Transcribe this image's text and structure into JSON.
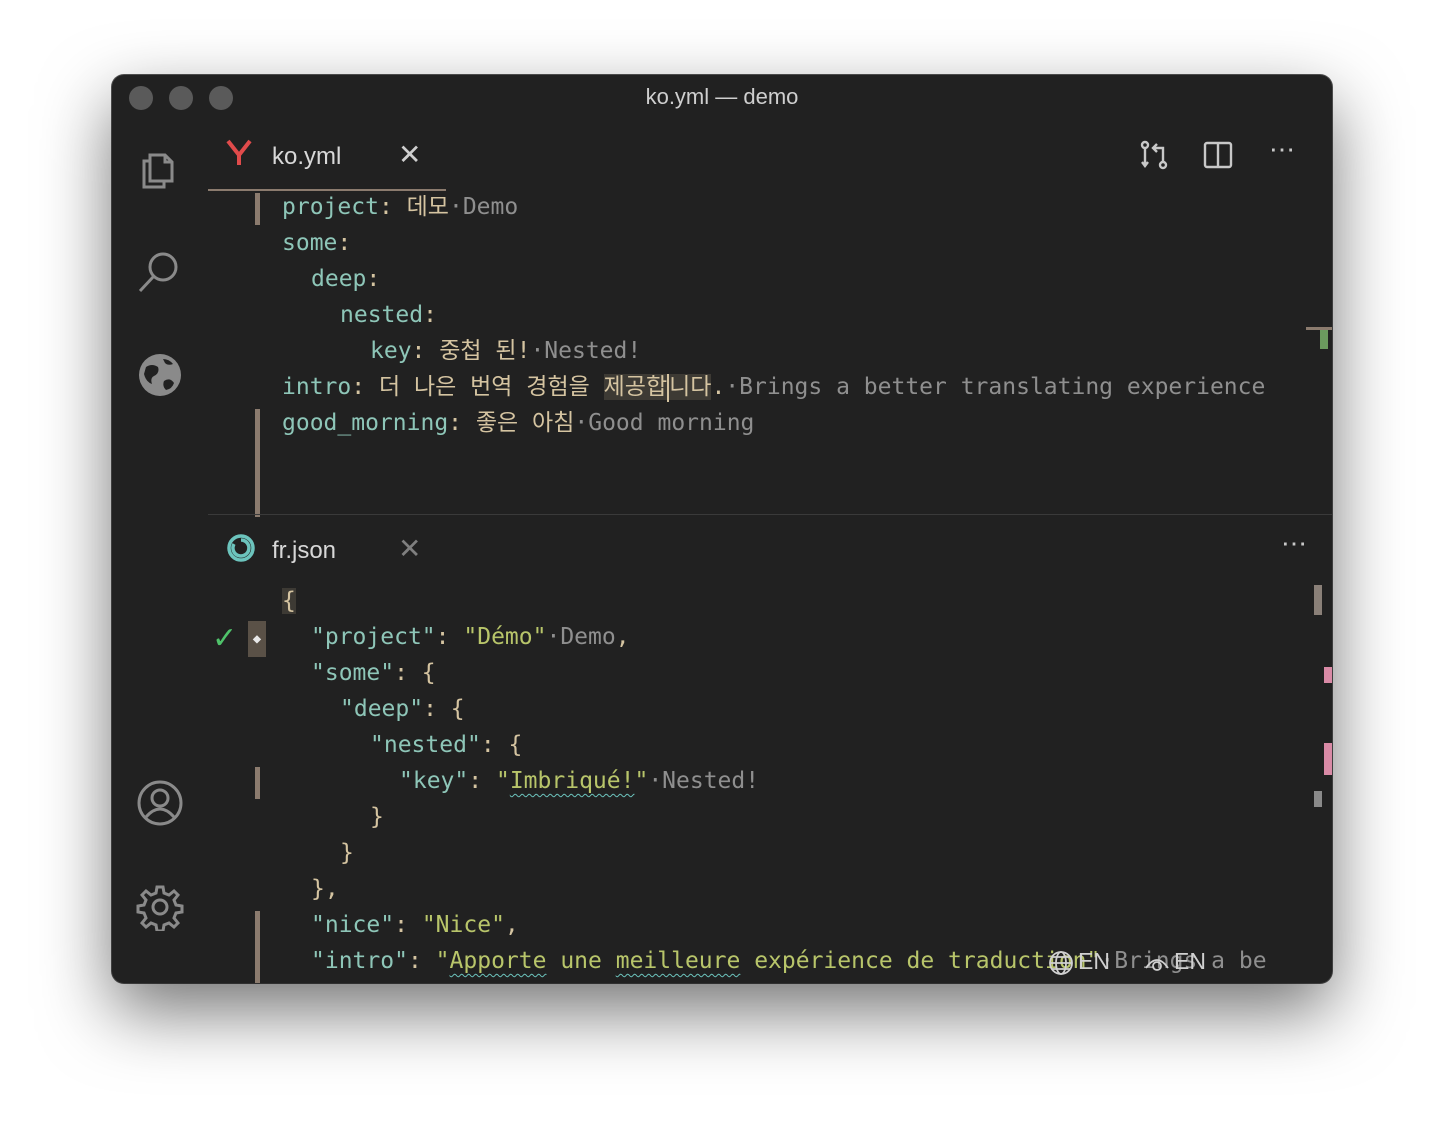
{
  "window": {
    "title": "ko.yml — demo"
  },
  "activity_bar": {
    "items": [
      "explorer-icon",
      "search-icon",
      "globe-icon",
      "account-icon",
      "settings-gear-icon"
    ]
  },
  "top_editor": {
    "tab": {
      "label": "ko.yml",
      "icon": "yaml-icon",
      "close": "✕"
    },
    "actions": {
      "more": "⋯"
    },
    "lines": [
      {
        "key": "project",
        "colon": ": ",
        "value": "데모",
        "dot": "·",
        "annotation": "Demo"
      },
      {
        "key": "some",
        "colon": ":"
      },
      {
        "key": "deep",
        "colon": ":"
      },
      {
        "key": "nested",
        "colon": ":"
      },
      {
        "key": "key",
        "colon": ": ",
        "value": "중첩 된!",
        "dot": "·",
        "annotation": "Nested!"
      },
      {
        "key": "intro",
        "colon": ": ",
        "value_a": "더 나은 번역 경험을 ",
        "value_hl_a": "제공합",
        "value_hl_b": "니다",
        "value_b": ".",
        "dot": "·",
        "annotation": "Brings a better translating experience"
      },
      {
        "key": "good_morning",
        "colon": ": ",
        "value": "좋은 아침",
        "dot": "·",
        "annotation": "Good morning"
      }
    ]
  },
  "bottom_editor": {
    "tab": {
      "label": "fr.json",
      "icon": "i18n-ally-icon",
      "close": "✕"
    },
    "actions": {
      "more": "⋯"
    },
    "gutter": {
      "check": "✓",
      "diamond": "◆"
    },
    "lines": [
      {
        "text": "{"
      },
      {
        "key": "project",
        "value": "Démo",
        "dot": "·",
        "annotation": "Demo",
        "tail": ","
      },
      {
        "key": "some",
        "tail": ": {"
      },
      {
        "key": "deep",
        "tail": ": {"
      },
      {
        "key": "nested",
        "tail": ": {"
      },
      {
        "key": "key",
        "value": "Imbriqué!",
        "dot": "·",
        "annotation": "Nested!"
      },
      {
        "text": "}"
      },
      {
        "text": "}"
      },
      {
        "text": "},"
      },
      {
        "key": "nice",
        "value": "Nice",
        "tail": ","
      },
      {
        "key": "intro",
        "value_a": "Apporte",
        "value_b": " une ",
        "value_c": "meilleure",
        "value_d": " expérience de traduction",
        "dot": "·",
        "annotation": "Brings a be"
      }
    ]
  },
  "status_bar": {
    "display_language": "EN",
    "source_language": "EN"
  },
  "colors": {
    "background": "#212121",
    "key": "#8ec6b8",
    "string": "#b8c56a",
    "annotation": "#8f8f8f",
    "accent": "#8b7b6e"
  }
}
